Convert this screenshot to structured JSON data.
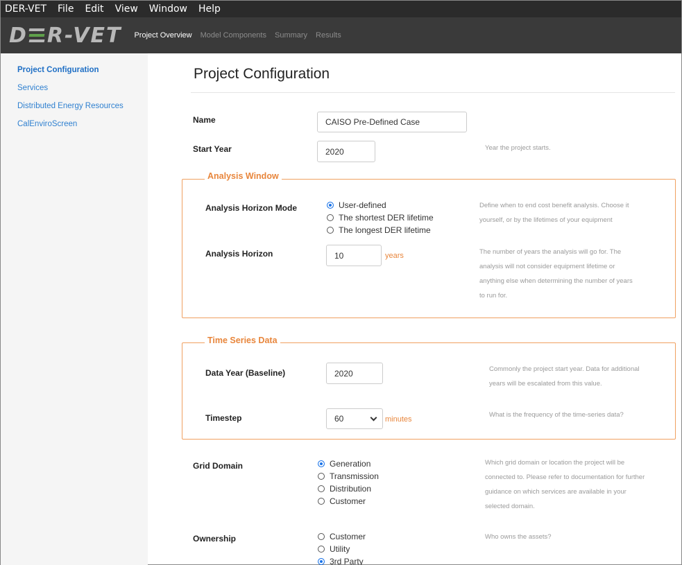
{
  "menubar": {
    "items": [
      "DER-VET",
      "File",
      "Edit",
      "View",
      "Window",
      "Help"
    ]
  },
  "app": {
    "logo_text_left": "D",
    "logo_text_right": "R-VET",
    "nav": [
      "Project Overview",
      "Model Components",
      "Summary",
      "Results"
    ]
  },
  "sidebar": {
    "items": [
      "Project Configuration",
      "Services",
      "Distributed Energy Resources",
      "CalEnviroScreen"
    ]
  },
  "main": {
    "title": "Project Configuration",
    "name": {
      "label": "Name",
      "value": "CAISO Pre-Defined Case"
    },
    "start_year": {
      "label": "Start Year",
      "value": "2020",
      "help": "Year the project starts."
    },
    "analysis_window": {
      "legend": "Analysis Window",
      "horizon_mode": {
        "label": "Analysis Horizon Mode",
        "options": [
          "User-defined",
          "The shortest DER lifetime",
          "The longest DER lifetime"
        ],
        "selected": 0,
        "help": [
          "Define when to end cost benefit analysis. Choose it",
          "yourself, or by the lifetimes of your equipment"
        ]
      },
      "horizon": {
        "label": "Analysis Horizon",
        "value": "10",
        "unit": "years",
        "help": [
          "The number of years the analysis will go for. The",
          "analysis will not consider equipment lifetime or",
          "anything else when determining the number of years",
          "to run for."
        ]
      }
    },
    "time_series": {
      "legend": "Time Series Data",
      "data_year": {
        "label": "Data Year (Baseline)",
        "value": "2020",
        "help": [
          "Commonly the project start year. Data for additional",
          "years will be escalated from this value."
        ]
      },
      "timestep": {
        "label": "Timestep",
        "value": "60",
        "unit": "minutes",
        "help": "What is the frequency of the time-series data?"
      }
    },
    "grid_domain": {
      "label": "Grid Domain",
      "options": [
        "Generation",
        "Transmission",
        "Distribution",
        "Customer"
      ],
      "selected": 0,
      "help": [
        "Which grid domain or location the project will be",
        "connected to. Please refer to documentation for further",
        "guidance on which services are available in your",
        "selected domain."
      ]
    },
    "ownership": {
      "label": "Ownership",
      "options": [
        "Customer",
        "Utility",
        "3rd Party"
      ],
      "selected": 2,
      "help": "Who owns the assets?"
    }
  },
  "colors": {
    "accent_orange": "#e8863c",
    "link_blue": "#2f80d0",
    "radio_blue": "#1a73e8",
    "header_dark": "#3a3a3a"
  }
}
